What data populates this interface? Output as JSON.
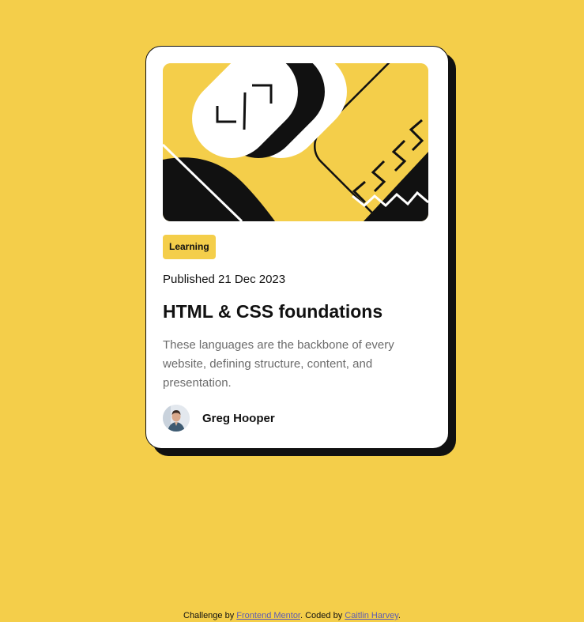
{
  "card": {
    "hero_image": "illustration-article",
    "category_tag": "Learning",
    "published": "Published 21 Dec 2023",
    "title": "HTML & CSS foundations",
    "description": "These languages are the backbone of every website, defining structure, content, and presentation.",
    "author": {
      "name": "Greg Hooper",
      "avatar": "avatar-photo"
    }
  },
  "footer": {
    "prefix": "Challenge by ",
    "challenge_link": "Frontend Mentor",
    "middle": ". Coded by ",
    "author_link": "Caitlin Harvey",
    "suffix": "."
  },
  "colors": {
    "background": "#F4CE4A",
    "card": "#FFFFFF",
    "text": "#111111",
    "muted": "#6B6B6B"
  }
}
